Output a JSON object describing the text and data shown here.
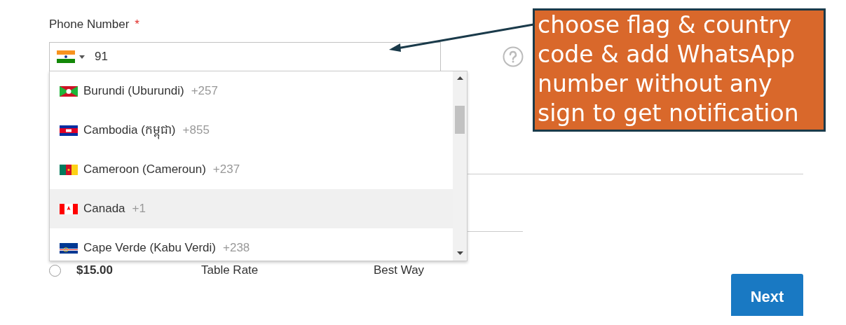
{
  "phone_field": {
    "label": "Phone Number",
    "required_mark": "*",
    "value": "91"
  },
  "country_options": [
    {
      "name": "Burundi (Uburundi)",
      "code": "+257",
      "selected": false
    },
    {
      "name": "Cambodia (កម្ពុជា)",
      "code": "+855",
      "selected": false
    },
    {
      "name": "Cameroon (Cameroun)",
      "code": "+237",
      "selected": false
    },
    {
      "name": "Canada",
      "code": "+1",
      "selected": true
    },
    {
      "name": "Cape Verde (Kabu Verdi)",
      "code": "+238",
      "selected": false
    }
  ],
  "shipping_method": {
    "selected": false,
    "price": "$15.00",
    "method": "Table Rate",
    "carrier": "Best Way"
  },
  "annotation": "choose flag & country code & add WhatsApp number without any sign to get notification",
  "next_button": "Next"
}
